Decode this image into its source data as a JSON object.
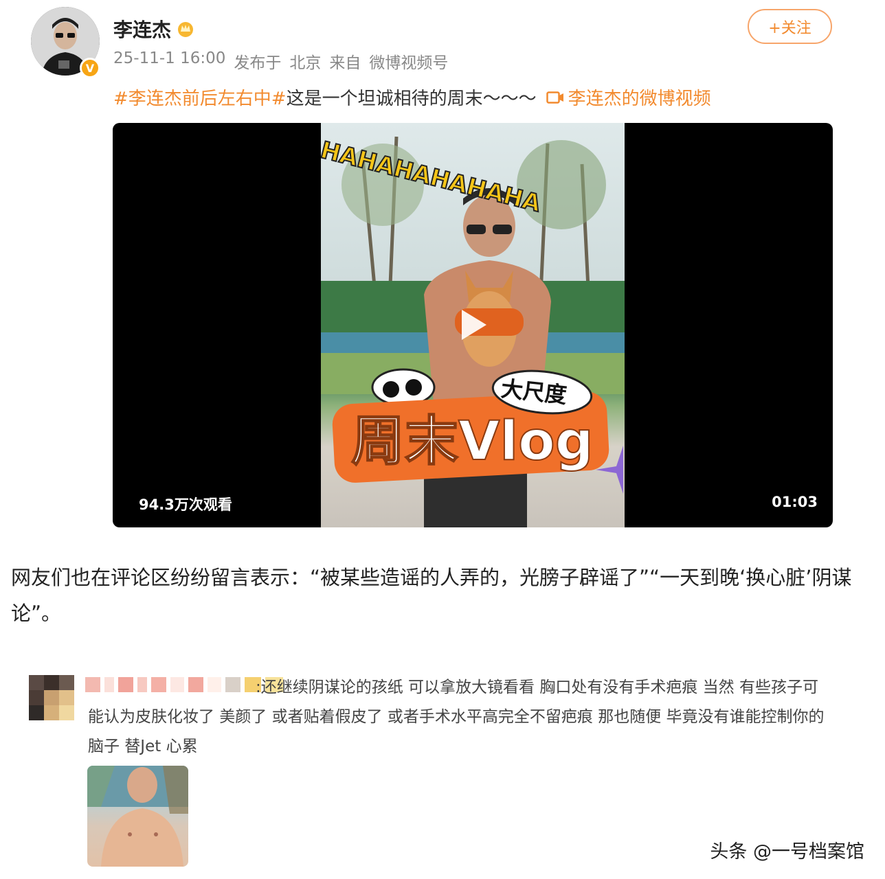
{
  "post": {
    "username": "李连杰",
    "badge_icon": "crown-icon",
    "verified_icon": "verified-v-icon",
    "timestamp": "25-11-1 16:00",
    "location_prefix": "发布于",
    "location": "北京",
    "source_prefix": "来自",
    "source": "微博视频号",
    "follow_label": "+关注",
    "hashtag": "#李连杰前后左右中#",
    "text": "这是一个坦诚相待的周末～～～",
    "video_link_label": "李连杰的微博视频"
  },
  "video": {
    "views": "94.3万次观看",
    "duration": "01:03",
    "overlay_text": "HAHAHAHAHAHA",
    "sticker_big": "大尺度",
    "sticker_title": "周末Vlog",
    "play_icon": "play-icon"
  },
  "article": {
    "paragraph": "网友们也在评论区纷纷留言表示：“被某些造谣的人弄的，光膀子辟谣了”“一天到晚‘换心脏’阴谋论”。"
  },
  "comment": {
    "text": ":还继续阴谋论的孩纸 可以拿放大镜看看 胸口处有没有手术疤痕 当然 有些孩子可能认为皮肤化妆了 美颜了 或者贴着假皮了 或者手术水平高完全不留疤痕 那也随便 毕竟没有谁能控制你的脑子 替Jet 心累"
  },
  "watermark": "头条 @一号档案馆",
  "colors": {
    "accent": "#f28a2e",
    "verified": "#f7a515"
  }
}
